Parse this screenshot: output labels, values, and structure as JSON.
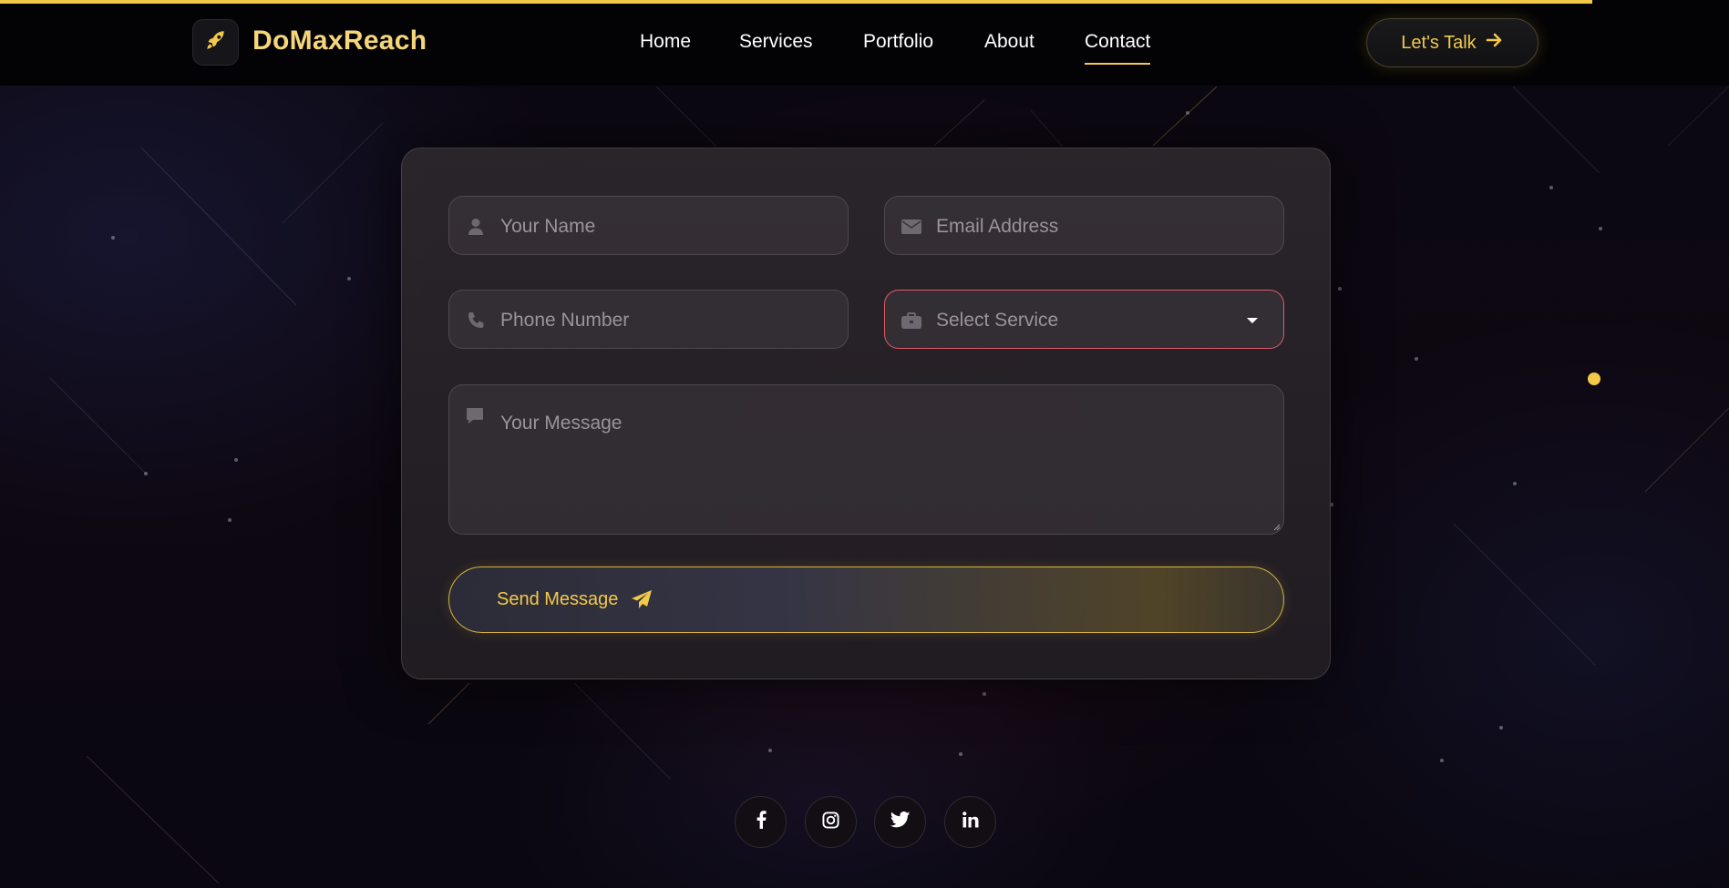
{
  "header": {
    "brand": "DoMaxReach",
    "logo_icon": "rocket-icon",
    "nav": [
      {
        "label": "Home",
        "active": false
      },
      {
        "label": "Services",
        "active": false
      },
      {
        "label": "Portfolio",
        "active": false
      },
      {
        "label": "About",
        "active": false
      },
      {
        "label": "Contact",
        "active": true
      }
    ],
    "cta_label": "Let's Talk",
    "cta_icon": "arrow-right-icon"
  },
  "form": {
    "name_placeholder": "Your Name",
    "name_icon": "user-icon",
    "email_placeholder": "Email Address",
    "email_icon": "envelope-icon",
    "phone_placeholder": "Phone Number",
    "phone_icon": "phone-icon",
    "service_placeholder": "Select Service",
    "service_icon": "briefcase-icon",
    "message_placeholder": "Your Message",
    "message_icon": "comment-icon",
    "submit_label": "Send Message",
    "submit_icon": "paper-plane-icon"
  },
  "social": [
    {
      "name": "facebook",
      "icon": "facebook-icon"
    },
    {
      "name": "instagram",
      "icon": "instagram-icon"
    },
    {
      "name": "twitter",
      "icon": "twitter-icon"
    },
    {
      "name": "linkedin",
      "icon": "linkedin-icon"
    }
  ],
  "colors": {
    "accent": "#f3c94a",
    "select_border": "#e05a6a",
    "header_bg": "#030305"
  }
}
